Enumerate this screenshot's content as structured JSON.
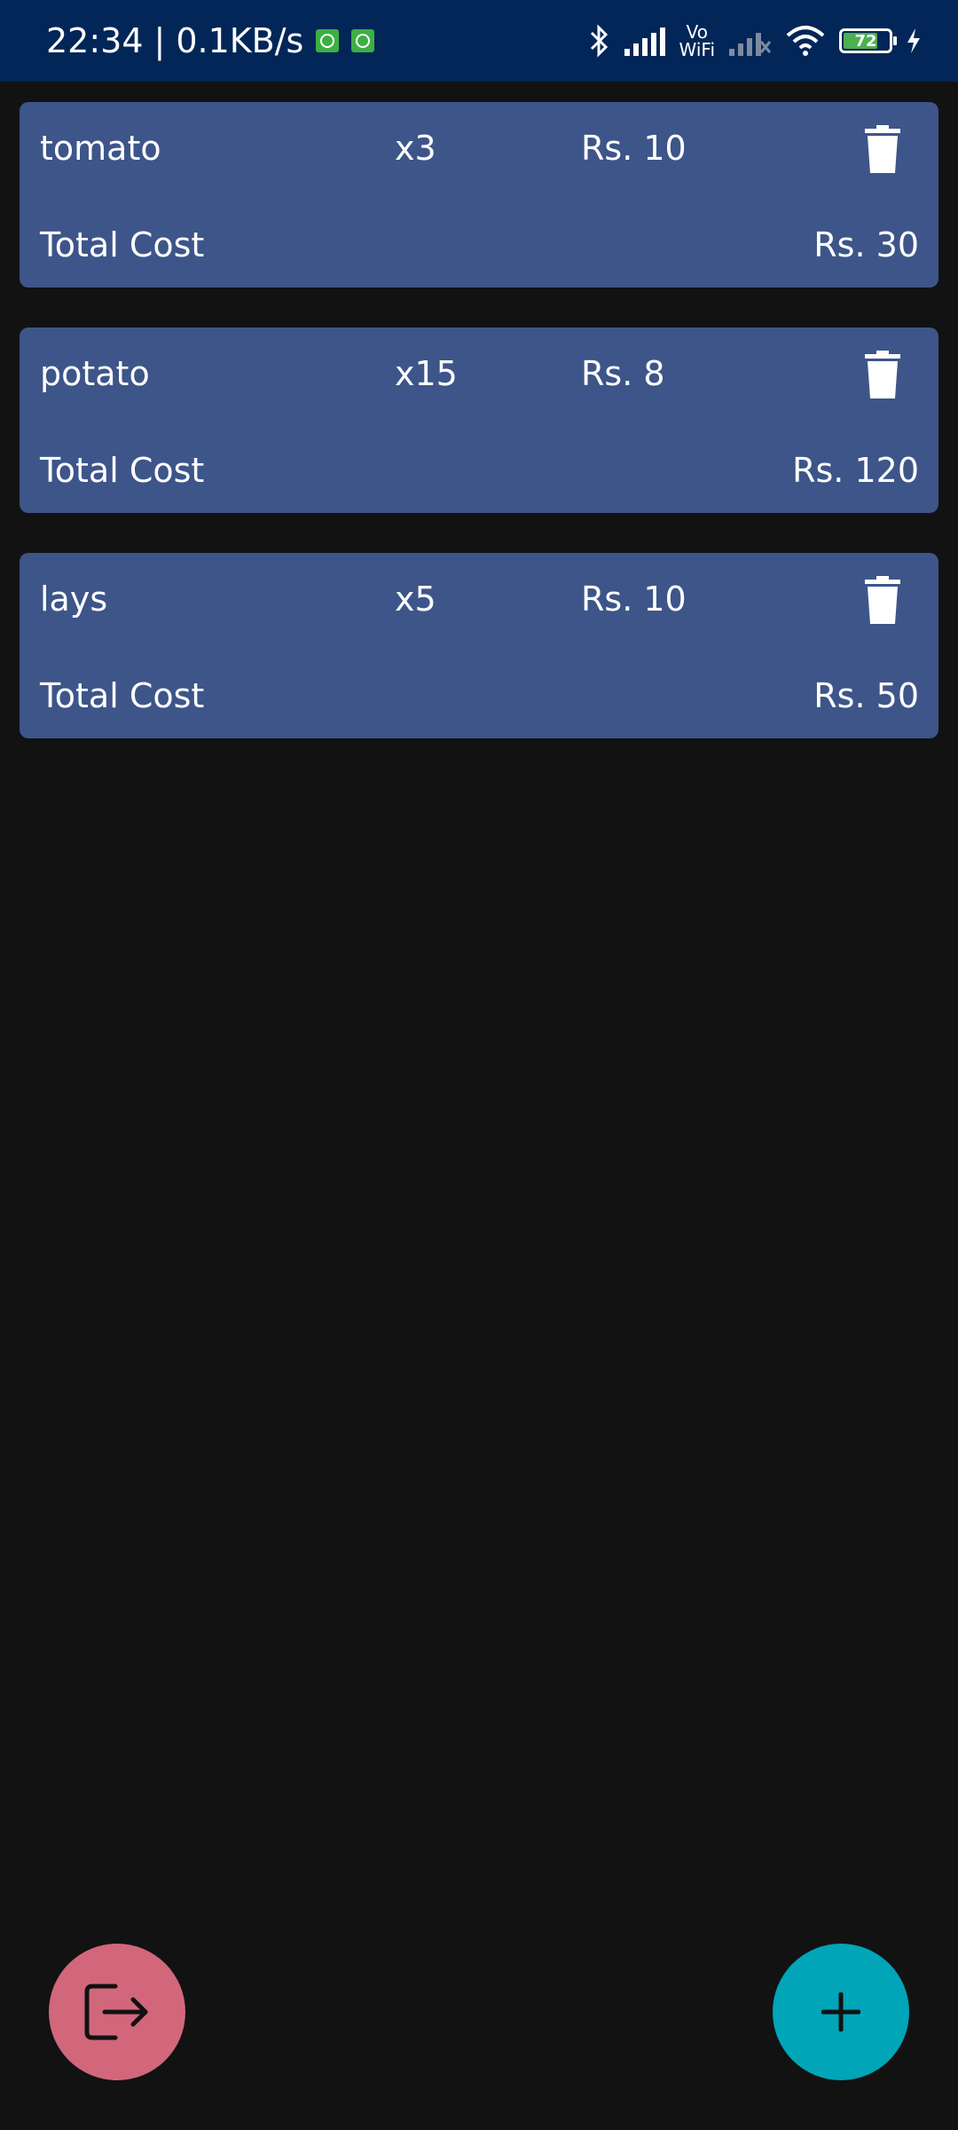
{
  "status_bar": {
    "time": "22:34",
    "separator": "|",
    "network_speed": "0.1KB/s",
    "vowifi_top": "Vo",
    "vowifi_bottom": "WiFi",
    "battery": "72",
    "icons": [
      "bluetooth-icon",
      "signal-icon",
      "vowifi-icon",
      "signal-weak-icon",
      "wifi-icon",
      "battery-icon",
      "charging-icon"
    ]
  },
  "items": [
    {
      "name": "tomato",
      "qty": "x3",
      "price": "Rs. 10",
      "total_label": "Total Cost",
      "total": "Rs. 30"
    },
    {
      "name": "potato",
      "qty": "x15",
      "price": "Rs. 8",
      "total_label": "Total Cost",
      "total": "Rs. 120"
    },
    {
      "name": "lays",
      "qty": "x5",
      "price": "Rs. 10",
      "total_label": "Total Cost",
      "total": "Rs. 50"
    }
  ],
  "fabs": {
    "logout_icon": "logout-icon",
    "add_icon": "plus-icon"
  },
  "colors": {
    "status_bar": "#022658",
    "background": "#121212",
    "card": "#3d5589",
    "logout_fab": "#d2677b",
    "add_fab": "#00a5b8"
  }
}
